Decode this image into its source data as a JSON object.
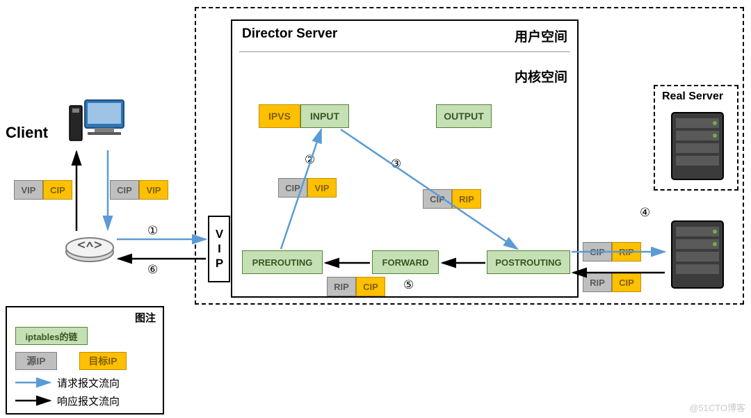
{
  "client_label": "Client",
  "director_box_title": "Director Server",
  "user_space": "用户空间",
  "kernel_space": "内核空间",
  "real_server_label": "Real Server",
  "chains": {
    "ipvs": "IPVS",
    "input": "INPUT",
    "output": "OUTPUT",
    "prerouting": "PREROUTING",
    "forward": "FORWARD",
    "postrouting": "POSTROUTING"
  },
  "vip_vertical": "VIP",
  "ips": {
    "vip": "VIP",
    "cip": "CIP",
    "rip": "RIP"
  },
  "steps": {
    "s1": "①",
    "s2": "②",
    "s3": "③",
    "s4": "④",
    "s5": "⑤",
    "s6": "⑥"
  },
  "legend": {
    "title": "图注",
    "iptables_chain": "iptables的链",
    "src_ip": "源IP",
    "dst_ip": "目标IP",
    "req_flow": "请求报文流向",
    "resp_flow": "响应报文流向"
  },
  "watermark": "@51CTO博客",
  "colors": {
    "green_bg": "#c5e0b4",
    "green_border": "#548235",
    "orange_bg": "#ffc000",
    "orange_border": "#bf8f00",
    "gray_bg": "#bfbfbf",
    "gray_border": "#7f7f7f",
    "blue_line": "#5b9bd5",
    "black_line": "#000000"
  },
  "diagram_flow": {
    "request": [
      "Client",
      "router",
      "VIP(Director)",
      "PREROUTING",
      "INPUT/IPVS",
      "POSTROUTING",
      "Real Server"
    ],
    "response": [
      "Real Server",
      "POSTROUTING",
      "FORWARD",
      "PREROUTING",
      "router",
      "Client"
    ],
    "packet_headers": {
      "client_out": {
        "src": "CIP",
        "dst": "VIP"
      },
      "client_in": {
        "src": "VIP",
        "dst": "CIP"
      },
      "pre_to_input": {
        "src": "CIP",
        "dst": "VIP"
      },
      "input_to_post": {
        "src": "CIP",
        "dst": "RIP"
      },
      "to_realserver": {
        "src": "CIP",
        "dst": "RIP"
      },
      "from_realserver": {
        "src": "RIP",
        "dst": "CIP"
      },
      "forward_back": {
        "src": "RIP",
        "dst": "CIP"
      }
    }
  }
}
